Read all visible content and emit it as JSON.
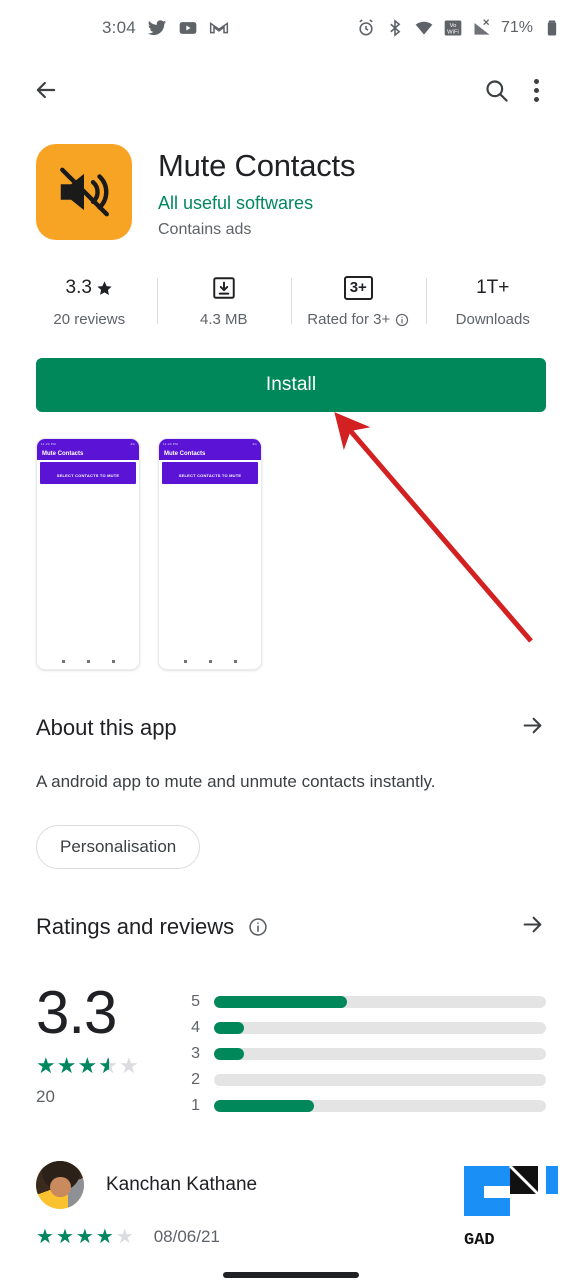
{
  "status_bar": {
    "time": "3:04",
    "left_icons": [
      "twitter-icon",
      "youtube-icon",
      "gmail-icon"
    ],
    "right_icons": [
      "alarm-icon",
      "bluetooth-icon",
      "wifi-icon",
      "vowifi-icon",
      "signal-icon"
    ],
    "battery_percent": "71%"
  },
  "app_bar": {
    "back_icon": "back-arrow-icon",
    "search_icon": "search-icon",
    "overflow_icon": "more-vertical-icon"
  },
  "app": {
    "icon": "mute-speaker-icon",
    "icon_color": "#F7A425",
    "title": "Mute Contacts",
    "developer": "All useful softwares",
    "ads_notice": "Contains ads"
  },
  "stats": [
    {
      "value": "3.3",
      "icon": "star-icon",
      "label": "20 reviews"
    },
    {
      "value": "",
      "icon": "download-box-icon",
      "label": "4.3 MB"
    },
    {
      "value": "3+",
      "icon": "content-rating-badge",
      "label": "Rated for 3+",
      "info": true
    },
    {
      "value": "1T+",
      "icon": "",
      "label": "Downloads"
    }
  ],
  "install": {
    "label": "Install",
    "color": "#00875A"
  },
  "screenshots": [
    {
      "status_left": "11:24 PM",
      "status_right": "4G",
      "title": "Mute Contacts",
      "cta": "SELECT CONTACTS TO MUTE",
      "bar_color": "#5B14D6"
    },
    {
      "status_left": "11:24 PM",
      "status_right": "4G",
      "title": "Mute Contacts",
      "cta": "SELECT CONTACTS TO MUTE",
      "bar_color": "#5B14D6"
    }
  ],
  "about": {
    "heading": "About this app",
    "arrow_icon": "arrow-right-icon",
    "description": "A android app to mute and unmute contacts instantly.",
    "tag": "Personalisation"
  },
  "ratings": {
    "heading": "Ratings and reviews",
    "info_icon": "info-icon",
    "arrow_icon": "arrow-right-icon",
    "score": "3.3",
    "stars": 3.5,
    "count": "20"
  },
  "chart_data": {
    "type": "bar",
    "title": "Ratings and reviews",
    "categories": [
      "5",
      "4",
      "3",
      "2",
      "1"
    ],
    "values": [
      40,
      9,
      9,
      0,
      30
    ],
    "xlabel": "",
    "ylabel": "",
    "ylim": [
      0,
      100
    ],
    "orientation": "horizontal",
    "bar_color": "#00875A",
    "track_color": "#e4e4e4",
    "average": 3.3,
    "total_ratings": 20
  },
  "review": {
    "avatar": "user-avatar",
    "name": "Kanchan Kathane",
    "stars": 4,
    "date": "08/06/21"
  },
  "annotation": {
    "arrow_color": "#D32020",
    "points_to": "install-button"
  },
  "watermark": {
    "label": "GAD"
  }
}
